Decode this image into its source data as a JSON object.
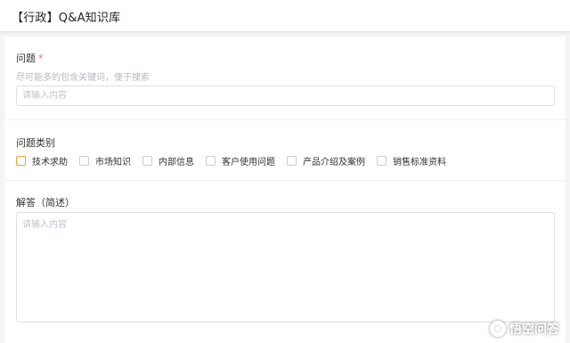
{
  "header": {
    "title": "【行政】Q&A知识库"
  },
  "form": {
    "question": {
      "label": "问题",
      "required_mark": "*",
      "hint": "尽可能多的包含关键词，便于搜索",
      "placeholder": "请输入内容",
      "value": ""
    },
    "category": {
      "label": "问题类别",
      "options": [
        {
          "label": "技术求助",
          "checked": false
        },
        {
          "label": "市场知识",
          "checked": false
        },
        {
          "label": "内部信息",
          "checked": false
        },
        {
          "label": "客户使用问题",
          "checked": false
        },
        {
          "label": "产品介绍及案例",
          "checked": false
        },
        {
          "label": "销售标准资料",
          "checked": false
        }
      ]
    },
    "answer": {
      "label": "解答（简述）",
      "placeholder": "请输入内容",
      "value": ""
    }
  },
  "watermark": {
    "text": "悟空问答"
  },
  "colors": {
    "required": "#f56c6c",
    "checkbox_focus": "#e6a23c",
    "border": "#dcdfe6",
    "placeholder": "#c0c4cc"
  }
}
